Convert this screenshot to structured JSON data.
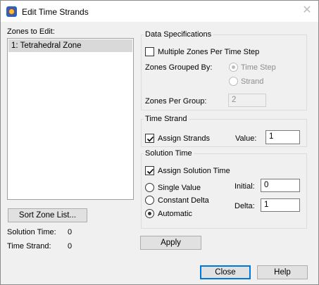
{
  "window": {
    "title": "Edit Time Strands"
  },
  "zones": {
    "label": "Zones to Edit:",
    "items": [
      "1: Tetrahedral Zone"
    ],
    "sort_button": "Sort Zone List...",
    "solution_time_label": "Solution Time:",
    "solution_time_value": "0",
    "time_strand_label": "Time Strand:",
    "time_strand_value": "0"
  },
  "data_spec": {
    "title": "Data Specifications",
    "multiple_zones_label": "Multiple Zones Per Time Step",
    "multiple_zones_checked": false,
    "grouped_by_label": "Zones Grouped By:",
    "option_time_step": "Time Step",
    "option_strand": "Strand",
    "zones_per_group_label": "Zones Per Group:",
    "zones_per_group_value": "2"
  },
  "time_strand": {
    "title": "Time Strand",
    "assign_label": "Assign Strands",
    "assign_checked": true,
    "value_label": "Value:",
    "value": "1"
  },
  "solution_time": {
    "title": "Solution Time",
    "assign_label": "Assign Solution Time",
    "assign_checked": true,
    "option_single": "Single Value",
    "option_constant": "Constant Delta",
    "option_automatic": "Automatic",
    "selected": "Automatic",
    "initial_label": "Initial:",
    "initial_value": "0",
    "delta_label": "Delta:",
    "delta_value": "1"
  },
  "buttons": {
    "apply": "Apply",
    "close": "Close",
    "help": "Help"
  }
}
